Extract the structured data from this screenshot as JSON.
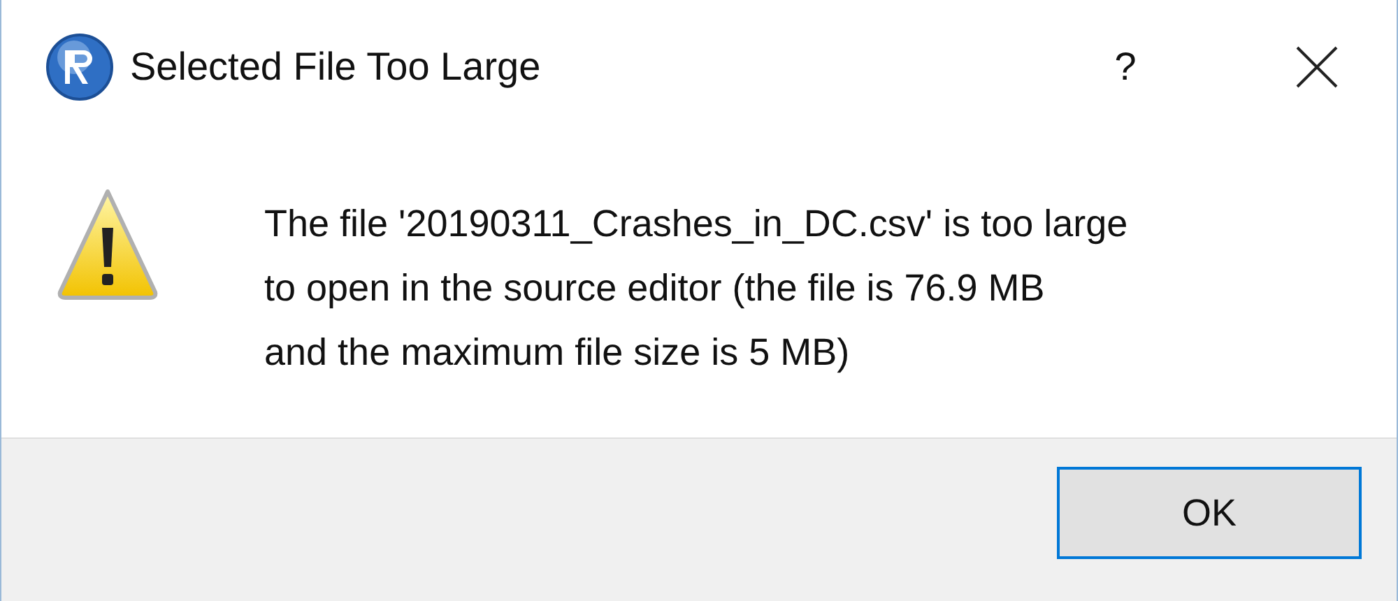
{
  "window": {
    "title": "Selected File Too Large",
    "help": "?"
  },
  "message": {
    "kind": "warning",
    "lines": [
      "The file '20190311_Crashes_in_DC.csv' is too large",
      "to open in the source editor (the file is 76.9 MB",
      "and the maximum file size is 5 MB)"
    ]
  },
  "buttons": [
    {
      "label": "OK",
      "focused": true
    }
  ]
}
